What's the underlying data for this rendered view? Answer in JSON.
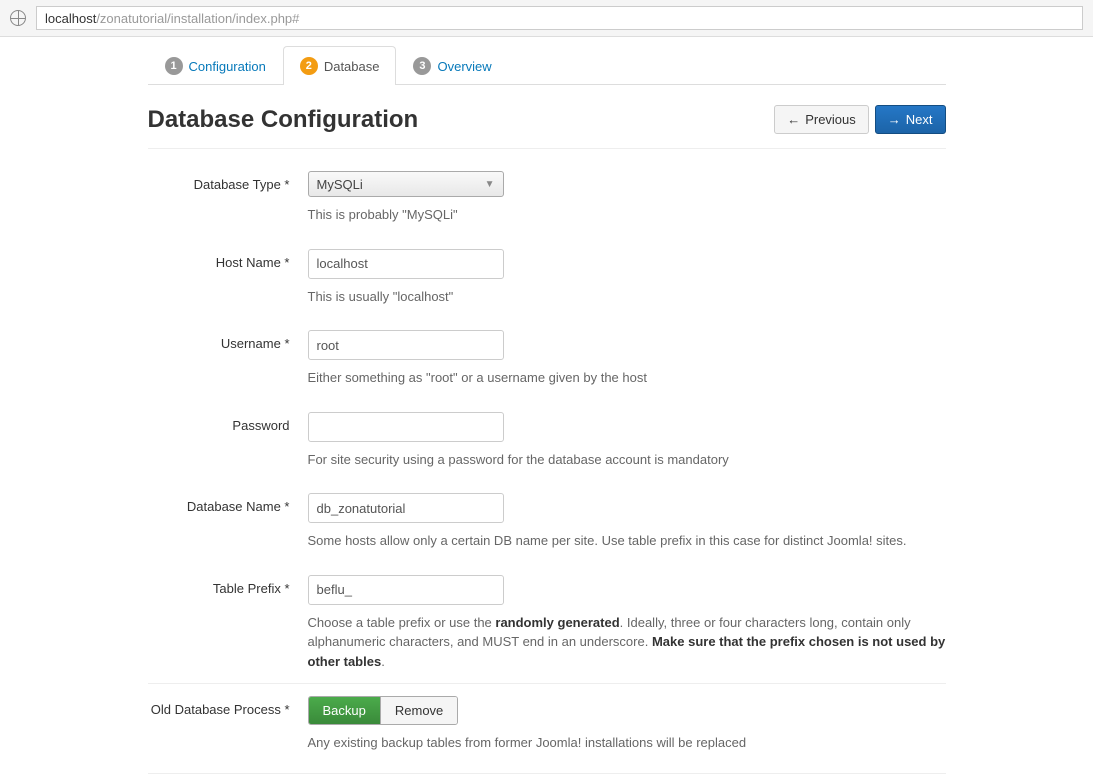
{
  "browser": {
    "url_host": "localhost",
    "url_path": "/zonatutorial/installation/index.php#"
  },
  "tabs": [
    {
      "num": "1",
      "label": "Configuration",
      "active": false
    },
    {
      "num": "2",
      "label": "Database",
      "active": true
    },
    {
      "num": "3",
      "label": "Overview",
      "active": false
    }
  ],
  "page_title": "Database Configuration",
  "buttons": {
    "previous": "Previous",
    "next": "Next"
  },
  "fields": {
    "db_type": {
      "label": "Database Type *",
      "value": "MySQLi",
      "help": "This is probably \"MySQLi\""
    },
    "host": {
      "label": "Host Name *",
      "value": "localhost",
      "help": "This is usually \"localhost\""
    },
    "username": {
      "label": "Username *",
      "value": "root",
      "help": "Either something as \"root\" or a username given by the host"
    },
    "password": {
      "label": "Password",
      "value": "",
      "help": "For site security using a password for the database account is mandatory"
    },
    "db_name": {
      "label": "Database Name *",
      "value": "db_zonatutorial",
      "help": "Some hosts allow only a certain DB name per site. Use table prefix in this case for distinct Joomla! sites."
    },
    "prefix": {
      "label": "Table Prefix *",
      "value": "beflu_",
      "help_pre": "Choose a table prefix or use the ",
      "help_bold1": "randomly generated",
      "help_mid": ". Ideally, three or four characters long, contain only alphanumeric characters, and MUST end in an underscore. ",
      "help_bold2": "Make sure that the prefix chosen is not used by other tables",
      "help_post": "."
    },
    "old_db": {
      "label": "Old Database Process *",
      "backup": "Backup",
      "remove": "Remove",
      "help": "Any existing backup tables from former Joomla! installations will be replaced"
    }
  }
}
